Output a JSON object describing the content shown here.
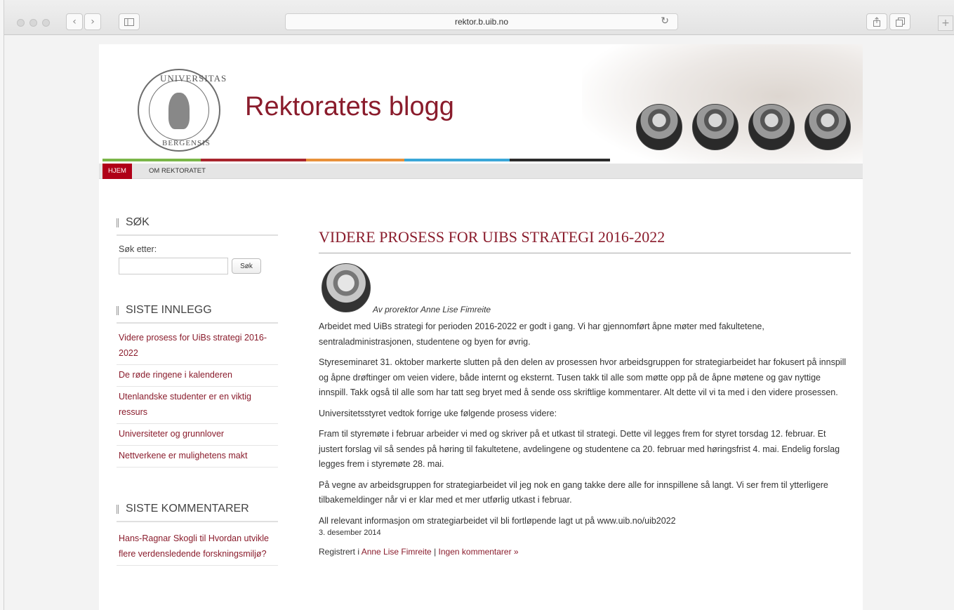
{
  "browser": {
    "url": "rektor.b.uib.no",
    "back_glyph": "‹",
    "forward_glyph": "›",
    "reload_glyph": "↻",
    "new_tab_glyph": "+"
  },
  "site": {
    "title": "Rektoratets blogg",
    "seal_text_top": "UNIVERSITAS",
    "seal_text_bottom": "BERGENSIS",
    "nav": [
      "HJEM",
      "OM REKTORATET"
    ]
  },
  "colors": {
    "accent": "#8a1c2c",
    "nav_active": "#b00018",
    "bar": [
      "#7ab648",
      "#a8252d",
      "#e8913a",
      "#3aa7d8",
      "#2b2b2b"
    ]
  },
  "sidebar": {
    "search": {
      "title": "SØK",
      "label": "Søk etter:",
      "button": "Søk",
      "value": ""
    },
    "recent": {
      "title": "SISTE INNLEGG",
      "items": [
        "Videre prosess for UiBs strategi 2016-2022",
        "De røde ringene i kalenderen",
        "Utenlandske studenter er en viktig ressurs",
        "Universiteter og grunnlover",
        "Nettverkene er mulighetens makt"
      ]
    },
    "comments": {
      "title": "SISTE KOMMENTARER",
      "items": [
        "Hans-Ragnar Skogli til Hvordan utvikle flere verdensledende forskningsmiljø?"
      ]
    }
  },
  "post": {
    "title": "VIDERE PROSESS FOR UIBS STRATEGI 2016-2022",
    "byline": "Av prorektor Anne Lise Fimreite",
    "paragraphs": [
      "Arbeidet med UiBs strategi for perioden 2016-2022 er godt i gang. Vi har gjennomført åpne møter med fakultetene, sentraladministrasjonen, studentene og byen for øvrig.",
      "Styreseminaret 31. oktober markerte slutten på den delen av prosessen hvor arbeidsgruppen for strategiarbeidet har fokusert på innspill og åpne drøftinger om veien videre, både internt og eksternt. Tusen takk til alle som møtte opp på de åpne møtene og gav nyttige innspill. Takk også til alle som har tatt seg bryet med å sende oss skriftlige kommentarer. Alt dette vil vi ta med i den videre prosessen.",
      "Universitetsstyret vedtok forrige uke følgende prosess videre:",
      "Fram til styremøte i februar arbeider vi med og skriver på et utkast til strategi. Dette vil legges frem for styret torsdag 12. februar. Et justert forslag vil så sendes på høring til fakultetene, avdelingene og studentene ca 20. februar med høringsfrist 4. mai. Endelig forslag legges frem i styremøte 28. mai.",
      "På vegne av arbeidsgruppen for strategiarbeidet vil jeg nok en gang takke dere alle for innspillene så langt. Vi ser frem til ytterligere tilbakemeldinger når vi er klar med et mer utførlig utkast i februar.",
      "All relevant informasjon om strategiarbeidet vil bli fortløpende lagt ut på www.uib.no/uib2022"
    ],
    "date": "3. desember 2014",
    "meta_prefix": "Registrert i",
    "category": "Anne Lise Fimreite",
    "separator": "|",
    "comments_link": "Ingen kommentarer »"
  }
}
